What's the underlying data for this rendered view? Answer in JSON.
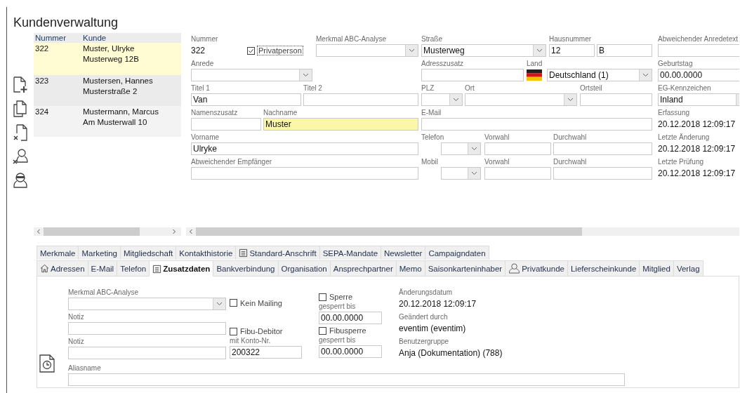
{
  "title": "Kundenverwaltung",
  "customer_list": {
    "columns": [
      "Nummer",
      "Kunde"
    ],
    "rows": [
      {
        "number": "322",
        "name": "Muster, Ulryke",
        "address": "Musterweg 12B",
        "selected": true
      },
      {
        "number": "323",
        "name": "Mustersen, Hannes",
        "address": "Musterstraße 2",
        "selected": false
      },
      {
        "number": "324",
        "name": "Mustermann, Marcus",
        "address": "Am Musterwall 10",
        "selected": false
      }
    ]
  },
  "form": {
    "nummer": {
      "label": "Nummer",
      "value": "322"
    },
    "privatperson": {
      "label": "Privatperson",
      "checked": true
    },
    "merkmal": {
      "label": "Merkmal ABC-Analyse"
    },
    "strasse": {
      "label": "Straße",
      "value": "Musterweg"
    },
    "hausnummer": {
      "label": "Hausnummer",
      "value": "12",
      "suffix": "B"
    },
    "anredetext": {
      "label": "Abweichender Anredetext"
    },
    "anrede": {
      "label": "Anrede"
    },
    "adresszusatz": {
      "label": "Adresszusatz"
    },
    "land": {
      "label": "Land",
      "value": "Deutschland (1)"
    },
    "geburtstag": {
      "label": "Geburtstag",
      "value": "00.00.0000"
    },
    "titel1": {
      "label": "Titel 1",
      "value": "Van"
    },
    "titel2": {
      "label": "Titel 2"
    },
    "plz": {
      "label": "PLZ"
    },
    "ort": {
      "label": "Ort"
    },
    "ortsteil": {
      "label": "Ortsteil"
    },
    "eg_kennzeichen": {
      "label": "EG-Kennzeichen",
      "value": "Inland"
    },
    "namenszusatz": {
      "label": "Namenszusatz"
    },
    "nachname": {
      "label": "Nachname",
      "value": "Muster",
      "highlighted": true
    },
    "email": {
      "label": "E-Mail"
    },
    "erfassung": {
      "label": "Erfassung",
      "value": "20.12.2018 12:09:17"
    },
    "vorname": {
      "label": "Vorname",
      "value": "Ulryke"
    },
    "telefon": {
      "label": "Telefon",
      "vorwahl_label": "Vorwahl",
      "durchwahl_label": "Durchwahl"
    },
    "letzte_aenderung": {
      "label": "Letzte Änderung",
      "value": "20.12.2018 12:09:17"
    },
    "empfaenger": {
      "label": "Abweichender Empfänger"
    },
    "mobil": {
      "label": "Mobil",
      "vorwahl_label": "Vorwahl",
      "durchwahl_label": "Durchwahl"
    },
    "letzte_pruefung": {
      "label": "Letzte Prüfung",
      "value": "20.12.2018 12:09:17"
    }
  },
  "tab_rows": [
    {
      "tabs": [
        {
          "label": "Merkmale",
          "kind": "plain",
          "selected": false
        },
        {
          "label": "Marketing",
          "kind": "plain",
          "selected": false
        },
        {
          "label": "Mitgliedschaft",
          "kind": "plain",
          "selected": false
        },
        {
          "label": "Kontakthistorie",
          "kind": "plain",
          "selected": false
        },
        {
          "label": "Standard-Anschrift",
          "kind": "document",
          "selected": false
        },
        {
          "label": "SEPA-Mandate",
          "kind": "plain",
          "selected": false
        },
        {
          "label": "Newsletter",
          "kind": "plain",
          "selected": false
        },
        {
          "label": "Campaigndaten",
          "kind": "plain",
          "selected": false
        }
      ]
    },
    {
      "tabs": [
        {
          "label": "Adressen",
          "kind": "home",
          "selected": false
        },
        {
          "label": "E-Mail",
          "kind": "plain",
          "selected": false
        },
        {
          "label": "Telefon",
          "kind": "plain",
          "selected": false
        },
        {
          "label": "Zusatzdaten",
          "kind": "document",
          "selected": true
        },
        {
          "label": "Bankverbindung",
          "kind": "plain",
          "selected": false
        },
        {
          "label": "Organisation",
          "kind": "plain",
          "selected": false
        },
        {
          "label": "Ansprechpartner",
          "kind": "plain",
          "selected": false
        },
        {
          "label": "Memo",
          "kind": "plain",
          "selected": false
        },
        {
          "label": "Saisonkarteninhaber",
          "kind": "plain",
          "selected": false
        },
        {
          "label": "Privatkunde",
          "kind": "person",
          "selected": false
        },
        {
          "label": "Lieferscheinkunde",
          "kind": "plain",
          "selected": false
        },
        {
          "label": "Mitglied",
          "kind": "plain",
          "selected": false
        },
        {
          "label": "Verlag",
          "kind": "plain",
          "selected": false
        }
      ]
    }
  ],
  "zusatzdaten": {
    "merkmal": {
      "label": "Merkmal ABC-Analyse"
    },
    "notiz_1": {
      "label": "Notiz"
    },
    "notiz_2": {
      "label": "Notiz"
    },
    "kein_mailing": {
      "label": "Kein Mailing",
      "checked": false
    },
    "fibu_debitor": {
      "label": "Fibu-Debitor",
      "checked": false
    },
    "konto": {
      "label": "mit Konto-Nr.",
      "value": "200322"
    },
    "sperre": {
      "label": "Sperre",
      "checked": false
    },
    "sperre_bis": {
      "label": "gesperrt bis",
      "value": "00.00.0000"
    },
    "fibusperre": {
      "label": "Fibusperre",
      "checked": false
    },
    "fibusperre_bis": {
      "label": "gesperrt bis",
      "value": "00.00.0000"
    },
    "aenderungsdatum": {
      "label": "Änderungsdatum",
      "value": "20.12.2018 12:09:17"
    },
    "geaendert_durch": {
      "label": "Geändert durch",
      "value": "eventim (eventim)"
    },
    "benutzergruppe": {
      "label": "Benutzergruppe",
      "value": "Anja (Dokumentation) (788)"
    },
    "aliasname": {
      "label": "Aliasname"
    }
  }
}
